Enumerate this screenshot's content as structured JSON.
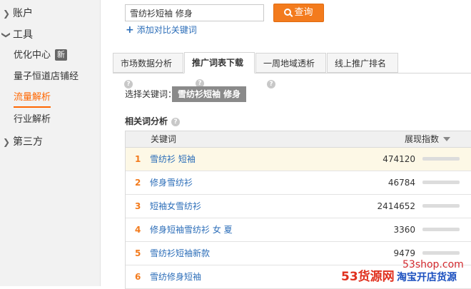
{
  "sidebar": {
    "groups": [
      {
        "label": "账户",
        "expanded": false
      },
      {
        "label": "工具",
        "expanded": true
      },
      {
        "label": "第三方",
        "expanded": false
      }
    ],
    "tool_items": [
      {
        "label": "优化中心",
        "badge": "新"
      },
      {
        "label": "量子恒道店铺经"
      },
      {
        "label": "流量解析",
        "active": true
      },
      {
        "label": "行业解析"
      }
    ]
  },
  "search": {
    "value": "雪纺衫短袖 修身",
    "button_label": "查询",
    "add_compare_label": "添加对比关键词"
  },
  "tabs": [
    {
      "label": "市场数据分析"
    },
    {
      "label": "推广词表下载",
      "active": true
    },
    {
      "label": "一周地域透析"
    },
    {
      "label": "线上推广排名"
    }
  ],
  "keyword_select": {
    "label": "选择关键词：",
    "selected": "雪纺衫短袖 修身"
  },
  "related": {
    "title": "相关词分析",
    "columns": {
      "keyword": "关键词",
      "index": "展现指数"
    },
    "rows": [
      {
        "rank": "1",
        "keyword": "雪纺衫 短袖",
        "index": "474120",
        "bar_fraction": 1.0
      },
      {
        "rank": "2",
        "keyword": "修身雪纺衫",
        "index": "46784",
        "bar_fraction": 1.0
      },
      {
        "rank": "3",
        "keyword": "短袖女雪纺衫",
        "index": "2414652",
        "bar_fraction": 1.0
      },
      {
        "rank": "4",
        "keyword": "修身短袖雪纺衫 女 夏",
        "index": "3360",
        "bar_fraction": 0.72
      },
      {
        "rank": "5",
        "keyword": "雪纺衫短袖新款",
        "index": "9479",
        "bar_fraction": 0.72
      },
      {
        "rank": "6",
        "keyword": "雪纺修身短袖",
        "index": "",
        "bar_fraction": 0.0
      }
    ]
  },
  "watermark": {
    "url": "53shop.com",
    "brand": "53货源网",
    "slogan": "淘宝开店货源"
  },
  "colors": {
    "accent": "#f37b1d",
    "link": "#2b6db8",
    "bar_fill": "#f28a1e"
  }
}
